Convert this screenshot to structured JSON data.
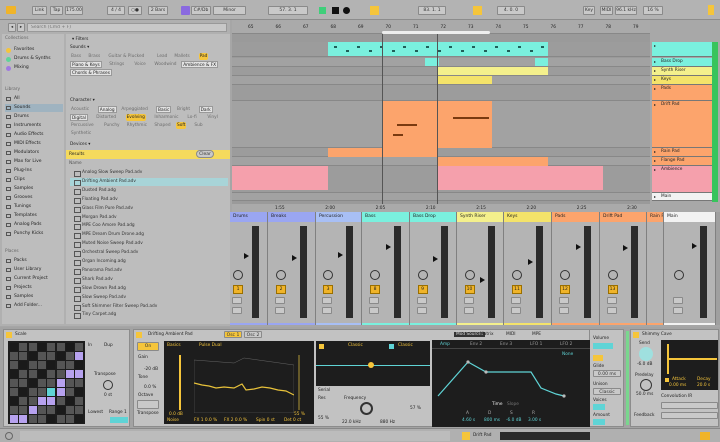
{
  "colors": {
    "accent": "#f5c53b",
    "cyan": "#7af0de",
    "yellow": "#f4f08c",
    "orange": "#fca46c",
    "pink": "#f5a0ac",
    "blue": "#9aa6f2",
    "meter": "#37c45c"
  },
  "topbar": {
    "link": "Link",
    "tap": "Tap",
    "tempo": "175.00",
    "meter_sig": "4 / 4",
    "metronome": "○●",
    "quantize": "2 Bars",
    "scale_icon": "scale-icon",
    "key_root": "C#/Db",
    "key_mode": "Minor",
    "position": "57.  3.  1",
    "loop_start": "83.  1.  1",
    "loop_length": "4.  0.  0",
    "key_label": "Key",
    "midi_label": "MIDI",
    "sample_rate": "96.1 kHz",
    "cpu": "16 %"
  },
  "browser": {
    "search_placeholder": "Search (Cmd + F)",
    "collections_head": "Collections",
    "collections": [
      {
        "label": "Favorites",
        "color": "#f5c53b"
      },
      {
        "label": "Drums & Synths",
        "color": "#5fd49a"
      },
      {
        "label": "Mixing",
        "color": "#a07ae0"
      }
    ],
    "library_head": "Library",
    "library": [
      "All",
      "Sounds",
      "Drums",
      "Instruments",
      "Audio Effects",
      "MIDI Effects",
      "Modulators",
      "Max for Live",
      "Plug-Ins",
      "Clips",
      "Samples",
      "Grooves",
      "Tunings",
      "Templates",
      "Analog Pads",
      "Punchy Kicks"
    ],
    "library_selected": "Sounds",
    "places_head": "Places",
    "places": [
      "Packs",
      "User Library",
      "Current Project",
      "Projects",
      "Samples",
      "Add Folder..."
    ],
    "filters_label": "Filters",
    "sounds_head": "Sounds ▾",
    "sounds_tags": [
      {
        "t": "Bass"
      },
      {
        "t": "Brass"
      },
      {
        "t": "Guitar & Plucked"
      },
      {
        "t": "Lead"
      },
      {
        "t": "Mallets"
      },
      {
        "t": "Pad",
        "on": true
      },
      {
        "t": "Piano & Keys",
        "box": true
      },
      {
        "t": "Strings"
      },
      {
        "t": "Voice"
      },
      {
        "t": "Woodwind"
      },
      {
        "t": "Ambience & FX",
        "box": true
      },
      {
        "t": "Chords & Phrases",
        "box": true
      }
    ],
    "character_head": "Character ▾",
    "character_tags": [
      {
        "t": "Acoustic"
      },
      {
        "t": "Analog",
        "box": true
      },
      {
        "t": "Arpeggiated"
      },
      {
        "t": "Basic",
        "box": true
      },
      {
        "t": "Bright"
      },
      {
        "t": "Dark",
        "box": true
      },
      {
        "t": "Digital",
        "box": true
      },
      {
        "t": "Distorted"
      },
      {
        "t": "Evolving",
        "on": true
      },
      {
        "t": "Inharmonic"
      },
      {
        "t": "Lo-fi"
      },
      {
        "t": "Vinyl"
      },
      {
        "t": "Percussive"
      },
      {
        "t": "Punchy"
      },
      {
        "t": "Rhythmic"
      },
      {
        "t": "Shaped"
      },
      {
        "t": "Soft",
        "on": true
      },
      {
        "t": "Sub"
      },
      {
        "t": "Synthetic"
      }
    ],
    "devices_head": "Devices ▾",
    "results_label": "Results",
    "clear_label": "Clear",
    "name_col": "Name",
    "results": [
      "Analog Slow Sweep Pad.adv",
      "Drifting Ambient Pad.adv",
      "Dusted Pad.adg",
      "Floating Pad.adv",
      "Glass Film Pure Pad.adv",
      "Morgan Pad.adv",
      "MPE Coo Amore Pad.adg",
      "MPE Dream Drum Drone.adg",
      "Muted Noise Sweep Pad.adv",
      "Orchestral Sweep Pad.adv",
      "Organ Incoming.adg",
      "Panorama Pad.adv",
      "Shark Pad.adv",
      "Slow Drown Pad.adg",
      "Slow Sweep Pad.adv",
      "Soft Shimmer Filter Sweep Pad.adv",
      "Tiny Carpet.adg"
    ],
    "results_selected": "Drifting Ambient Pad.adv"
  },
  "arrangement": {
    "bars": [
      "65",
      "66",
      "67",
      "68",
      "69",
      "70",
      "71",
      "72",
      "73",
      "74",
      "75",
      "76",
      "77",
      "78",
      "79"
    ],
    "times": [
      "1:55",
      "2:00",
      "2:05",
      "2:10",
      "2:15",
      "2:20",
      "2:25",
      "2:30"
    ],
    "tracks": [
      {
        "name": "",
        "color": "#7af0de"
      },
      {
        "name": "Bass Drop",
        "color": "#7af0de"
      },
      {
        "name": "Synth Riser",
        "color": "#f4f08c"
      },
      {
        "name": "Keys",
        "color": "#f4e36a"
      },
      {
        "name": "Pads",
        "color": "#fca46c"
      },
      {
        "name": "Drift Pad",
        "color": "#fca46c"
      },
      {
        "name": "Rain Pad",
        "color": "#fca46c"
      },
      {
        "name": "Flange Pad",
        "color": "#fca46c"
      },
      {
        "name": "Ambience",
        "color": "#f5a0ac"
      },
      {
        "name": "Main",
        "color": "#f2f2f2"
      }
    ],
    "zoom_label": "1 Bar"
  },
  "mixer": {
    "strips": [
      {
        "name": "Drums",
        "color": "#9aa6f2",
        "num": "1",
        "level": 0.55
      },
      {
        "name": "Breaks",
        "color": "#9aa6f2",
        "num": "2",
        "level": 0.52
      },
      {
        "name": "Percussion",
        "color": "#a8bff5",
        "num": "3",
        "level": 0.56
      },
      {
        "name": "Bass",
        "color": "#7af0de",
        "num": "8",
        "level": 0.7
      },
      {
        "name": "Bass Drop",
        "color": "#7af0de",
        "num": "9",
        "level": 0.5
      },
      {
        "name": "Synth Riser",
        "color": "#f4f08c",
        "num": "10",
        "level": 0.15
      },
      {
        "name": "Keys",
        "color": "#f4e36a",
        "num": "11",
        "level": 0.45
      },
      {
        "name": "Pads",
        "color": "#fca46c",
        "num": "12",
        "level": 0.7
      },
      {
        "name": "Drift Pad",
        "color": "#fca46c",
        "num": "13",
        "level": 0.68
      },
      {
        "name": "Rain P",
        "color": "#fca46c",
        "num": "14",
        "level": 0.6
      },
      {
        "name": "Main",
        "color": "#f2f2f2",
        "num": "",
        "level": 0.72
      }
    ]
  },
  "devices": {
    "scale": {
      "title": "Scale",
      "in": "In",
      "dup": "Dup",
      "transpose": "Transpose",
      "transpose_val": "0 st",
      "lowest": "Lowest",
      "range": "Range 1"
    },
    "rack": {
      "title": "Drifting Ambient Pad",
      "tab1": "Osc 1",
      "tab2": "Osc 2",
      "on": "On",
      "gain": "Gain",
      "gain_val": "-20 dB",
      "tone": "Tone",
      "tone_val": "0.0 %",
      "octave": "Octave",
      "transpose": "Transpose",
      "mode": "Basics",
      "wave": "Pulse Dual",
      "level": "0.0 dB",
      "pct": "55 %",
      "noise": "Noise",
      "fx1": "FX 1  0.0 %",
      "fx2": "FX 2  0.0 %",
      "spin": "Spin  0 st",
      "det": "Det  0 ct"
    },
    "filter": {
      "f1": "Filter 1",
      "type1": "Classic",
      "type2": "Classic",
      "serial": "Serial",
      "res": "Res",
      "res_val": "55 %",
      "freq": "Frequency",
      "freq_val": "22.0 kHz",
      "freq2_val": "880 Hz",
      "res2_val": "57 %"
    },
    "mod": {
      "tabs": [
        "Mod Sources",
        "Matrix",
        "MIDI",
        "MPE"
      ],
      "subtabs": [
        "Amp",
        "Env 2",
        "Env 3",
        "LFO 1",
        "LFO 2"
      ],
      "none": "None",
      "time": "Time",
      "slope": "Slope",
      "vals": [
        "4.60 s",
        "800 ms",
        "-6.0 dB",
        "3.00 s"
      ],
      "letters": [
        "A",
        "D",
        "S",
        "R"
      ]
    },
    "voice": {
      "volume": "Volume",
      "glide": "Glide",
      "glide_val": "0.00 ms",
      "unison": "Unison",
      "unison_val": "Classic",
      "voices": "Voices",
      "amount": "Amount"
    },
    "reverb": {
      "title": "Shimmy Cave",
      "send": "Send",
      "send_val": "-6.0 dB",
      "predelay": "Predelay",
      "predelay_val": "50.0 ms",
      "feedback": "Feedback",
      "attack": "Attack",
      "decay": "Decay",
      "attack_val": "0.00 ms",
      "decay_val": "20.0 s",
      "convolution": "Convolution IR"
    }
  },
  "status": {
    "track": "Drift Pad"
  }
}
